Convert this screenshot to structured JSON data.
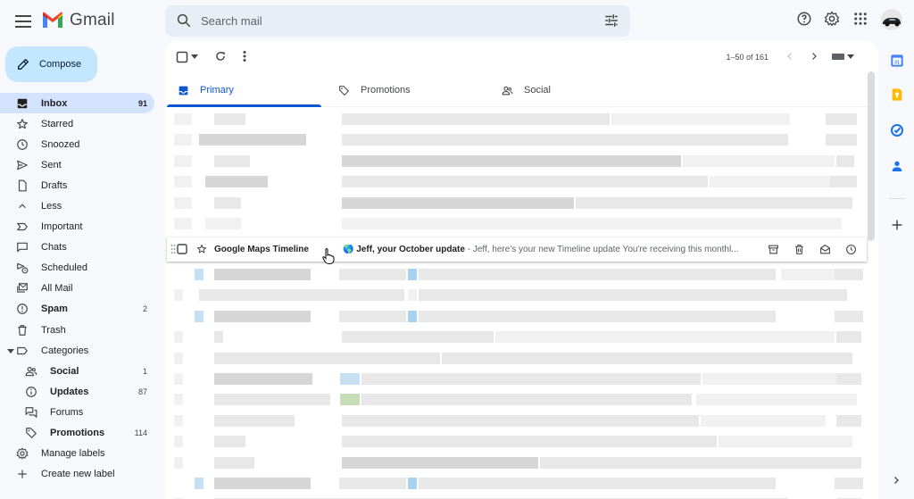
{
  "app": {
    "brand": "Gmail",
    "colors": {
      "accent": "#0b57d0",
      "compose_bg": "#c2e7ff",
      "active_nav": "#d3e3fd"
    }
  },
  "search": {
    "placeholder": "Search mail"
  },
  "compose": {
    "label": "Compose"
  },
  "nav": {
    "inbox": {
      "label": "Inbox",
      "count": "91"
    },
    "starred": {
      "label": "Starred"
    },
    "snoozed": {
      "label": "Snoozed"
    },
    "sent": {
      "label": "Sent"
    },
    "drafts": {
      "label": "Drafts"
    },
    "less": {
      "label": "Less"
    },
    "important": {
      "label": "Important"
    },
    "chats": {
      "label": "Chats"
    },
    "scheduled": {
      "label": "Scheduled"
    },
    "allmail": {
      "label": "All Mail"
    },
    "spam": {
      "label": "Spam",
      "count": "2"
    },
    "trash": {
      "label": "Trash"
    },
    "categories": {
      "label": "Categories"
    },
    "social": {
      "label": "Social",
      "count": "1"
    },
    "updates": {
      "label": "Updates",
      "count": "87"
    },
    "forums": {
      "label": "Forums"
    },
    "promotions": {
      "label": "Promotions",
      "count": "114"
    },
    "manage_labels": {
      "label": "Manage labels"
    },
    "create_label": {
      "label": "Create new label"
    }
  },
  "toolbar": {
    "pager": "1–50 of 161"
  },
  "tabs": {
    "primary": "Primary",
    "promotions": "Promotions",
    "social": "Social"
  },
  "hover_email": {
    "sender": "Google Maps Timeline",
    "emoji": "🌎",
    "subject": "Jeff, your October update",
    "separator": " - ",
    "snippet": "Jeff, here's your new Timeline update You're receiving this monthl..."
  },
  "icons": {
    "header": [
      "menu-icon",
      "search-icon",
      "tune-icon",
      "help-icon",
      "settings-icon",
      "apps-icon"
    ],
    "rail": [
      "calendar-icon",
      "keep-icon",
      "tasks-icon",
      "contacts-icon",
      "add-icon"
    ]
  }
}
